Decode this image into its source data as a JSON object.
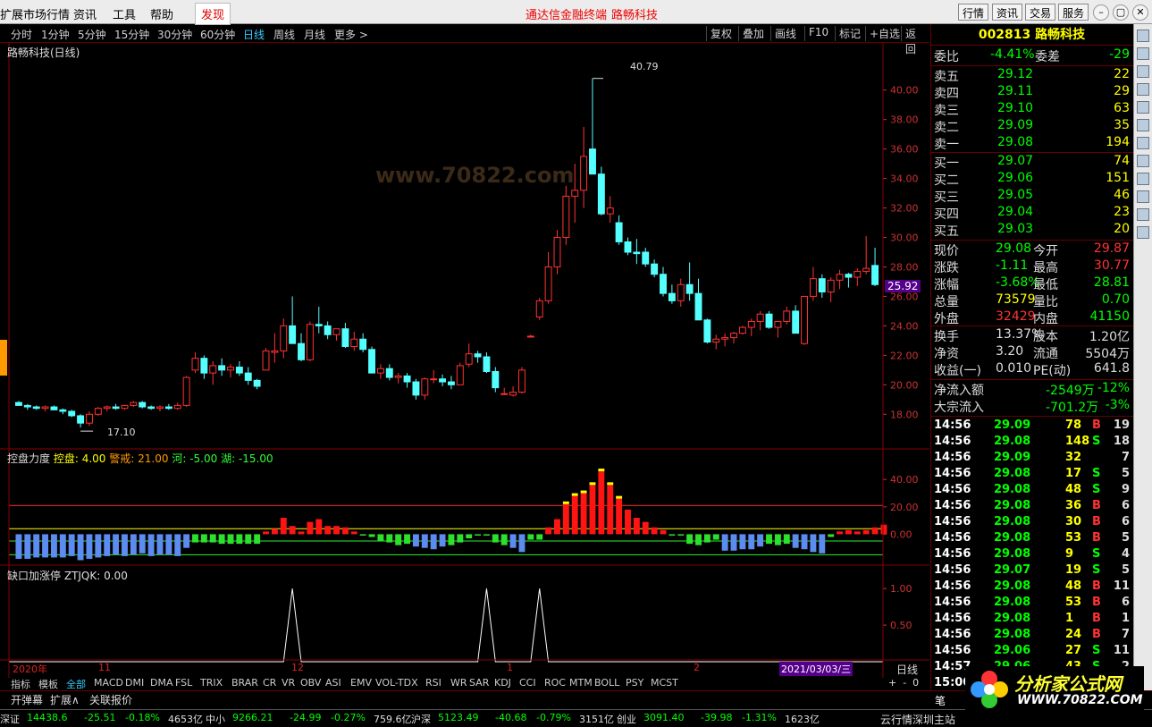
{
  "menubar": {
    "items": [
      "扩展市场行情",
      "资讯",
      "工具",
      "帮助"
    ],
    "find": "发现",
    "center_left": "通达信金融终端",
    "center_right": "路畅科技",
    "right_buttons": [
      "行情",
      "资讯",
      "交易",
      "服务"
    ]
  },
  "periods": {
    "items": [
      "分时",
      "1分钟",
      "5分钟",
      "15分钟",
      "30分钟",
      "60分钟",
      "日线",
      "周线",
      "月线",
      "更多 >"
    ],
    "active": "日线"
  },
  "toolbar": {
    "buttons": [
      "复权",
      "叠加",
      "画线",
      "F10",
      "标记",
      "+自选",
      "返回"
    ]
  },
  "main_chart": {
    "title": "路畅科技(日线)",
    "high_label": "40.79",
    "low_label": "17.10",
    "price_tag": "25.92",
    "watermark": "分析家公式网 WWW.70822.COM",
    "watermark_url": "www.70822.com"
  },
  "chart_data": [
    {
      "type": "candlestick",
      "name": "路畅科技",
      "yticks": [
        "40.00",
        "38.00",
        "36.00",
        "34.00",
        "32.00",
        "30.00",
        "28.00",
        "26.00",
        "24.00",
        "22.00",
        "20.00",
        "18.00"
      ],
      "ylim": [
        16.5,
        41.5
      ],
      "high": 40.79,
      "low": 17.1,
      "ohlc": [
        [
          18.8,
          18.9,
          18.6,
          18.6
        ],
        [
          18.6,
          18.7,
          18.3,
          18.5
        ],
        [
          18.5,
          18.6,
          18.3,
          18.4
        ],
        [
          18.4,
          18.6,
          18.2,
          18.5
        ],
        [
          18.5,
          18.6,
          18.3,
          18.3
        ],
        [
          18.3,
          18.4,
          18.0,
          18.2
        ],
        [
          18.2,
          18.3,
          17.8,
          17.9
        ],
        [
          17.9,
          18.0,
          17.1,
          17.4
        ],
        [
          17.4,
          18.2,
          17.2,
          18.0
        ],
        [
          18.0,
          18.5,
          17.9,
          18.4
        ],
        [
          18.4,
          18.6,
          18.2,
          18.5
        ],
        [
          18.5,
          18.7,
          18.3,
          18.4
        ],
        [
          18.4,
          18.6,
          18.3,
          18.6
        ],
        [
          18.6,
          18.9,
          18.5,
          18.8
        ],
        [
          18.8,
          18.9,
          18.4,
          18.5
        ],
        [
          18.5,
          18.6,
          18.3,
          18.4
        ],
        [
          18.4,
          18.6,
          18.2,
          18.5
        ],
        [
          18.5,
          18.7,
          18.3,
          18.4
        ],
        [
          18.4,
          18.8,
          18.3,
          18.6
        ],
        [
          18.6,
          20.6,
          18.5,
          20.5
        ],
        [
          21.0,
          22.2,
          20.8,
          21.8
        ],
        [
          21.8,
          22.0,
          20.4,
          20.8
        ],
        [
          20.8,
          21.6,
          20.0,
          21.3
        ],
        [
          21.3,
          21.8,
          20.6,
          21.0
        ],
        [
          21.0,
          21.4,
          20.5,
          21.2
        ],
        [
          21.2,
          21.6,
          20.6,
          20.8
        ],
        [
          20.8,
          21.2,
          20.0,
          20.3
        ],
        [
          20.3,
          20.4,
          19.7,
          19.9
        ],
        [
          21.0,
          22.5,
          21.0,
          22.3
        ],
        [
          22.2,
          23.5,
          21.5,
          22.3
        ],
        [
          22.3,
          24.5,
          21.8,
          24.0
        ],
        [
          24.0,
          26.0,
          23.0,
          22.8
        ],
        [
          22.8,
          23.5,
          21.6,
          21.7
        ],
        [
          21.7,
          24.3,
          21.6,
          24.1
        ],
        [
          24.1,
          25.3,
          23.5,
          24.0
        ],
        [
          24.0,
          24.3,
          23.1,
          23.4
        ],
        [
          23.4,
          23.8,
          23.0,
          23.8
        ],
        [
          23.8,
          24.2,
          22.5,
          22.6
        ],
        [
          22.6,
          23.6,
          22.3,
          23.1
        ],
        [
          23.1,
          23.5,
          22.2,
          22.4
        ],
        [
          22.4,
          22.6,
          20.8,
          20.8
        ],
        [
          20.8,
          21.4,
          20.4,
          21.1
        ],
        [
          21.1,
          21.4,
          20.3,
          20.5
        ],
        [
          20.5,
          20.8,
          20.1,
          20.6
        ],
        [
          20.6,
          20.8,
          19.8,
          20.2
        ],
        [
          20.2,
          20.4,
          19.0,
          19.3
        ],
        [
          19.3,
          20.5,
          19.0,
          20.4
        ],
        [
          20.4,
          21.0,
          20.1,
          20.4
        ],
        [
          20.4,
          20.7,
          19.9,
          20.2
        ],
        [
          20.2,
          20.6,
          19.7,
          20.0
        ],
        [
          20.0,
          21.5,
          20.0,
          21.3
        ],
        [
          21.4,
          22.8,
          21.2,
          22.1
        ],
        [
          22.1,
          22.3,
          21.5,
          21.9
        ],
        [
          21.9,
          22.2,
          20.8,
          20.9
        ],
        [
          20.9,
          21.2,
          19.5,
          19.8
        ],
        [
          19.4,
          19.8,
          19.3,
          19.4
        ],
        [
          19.3,
          19.9,
          19.2,
          19.5
        ],
        [
          19.5,
          21.2,
          19.4,
          21.0
        ],
        [
          23.3,
          23.4,
          23.2,
          23.3
        ],
        [
          24.6,
          25.9,
          24.4,
          25.7
        ],
        [
          25.7,
          29.0,
          25.5,
          28.0
        ],
        [
          28.0,
          30.5,
          27.5,
          30.0
        ],
        [
          30.0,
          33.5,
          29.5,
          32.8
        ],
        [
          32.8,
          35.0,
          31.0,
          33.2
        ],
        [
          33.2,
          37.5,
          32.0,
          35.5
        ],
        [
          36.0,
          40.8,
          34.5,
          34.3
        ],
        [
          34.3,
          34.8,
          31.5,
          31.6
        ],
        [
          31.6,
          32.8,
          31.0,
          32.0
        ],
        [
          31.0,
          31.5,
          29.5,
          29.7
        ],
        [
          29.7,
          30.0,
          28.8,
          29.0
        ],
        [
          29.0,
          29.9,
          28.2,
          28.9
        ],
        [
          29.0,
          29.3,
          28.0,
          28.2
        ],
        [
          28.2,
          28.5,
          27.3,
          27.5
        ],
        [
          27.5,
          28.0,
          26.0,
          26.2
        ],
        [
          26.2,
          26.8,
          25.5,
          25.7
        ],
        [
          25.7,
          27.2,
          25.3,
          26.8
        ],
        [
          26.8,
          28.3,
          25.7,
          26.2
        ],
        [
          26.2,
          27.2,
          24.4,
          24.4
        ],
        [
          24.4,
          24.5,
          22.8,
          22.9
        ],
        [
          22.9,
          23.4,
          22.4,
          23.1
        ],
        [
          23.1,
          23.5,
          22.6,
          23.2
        ],
        [
          23.2,
          23.6,
          22.8,
          23.5
        ],
        [
          23.5,
          24.0,
          23.4,
          23.9
        ],
        [
          23.9,
          24.5,
          23.3,
          24.3
        ],
        [
          24.3,
          25.0,
          23.7,
          24.8
        ],
        [
          24.8,
          25.0,
          23.8,
          23.9
        ],
        [
          23.9,
          24.2,
          23.2,
          24.3
        ],
        [
          24.3,
          25.3,
          24.1,
          25.0
        ],
        [
          25.0,
          25.4,
          23.5,
          23.5
        ],
        [
          22.8,
          26.0,
          22.7,
          26.0
        ],
        [
          26.0,
          28.0,
          25.7,
          27.2
        ],
        [
          27.2,
          27.5,
          25.9,
          26.3
        ],
        [
          26.3,
          27.3,
          25.6,
          27.1
        ],
        [
          27.1,
          27.8,
          26.5,
          27.5
        ],
        [
          27.5,
          27.6,
          26.6,
          27.3
        ],
        [
          27.3,
          27.9,
          26.7,
          27.7
        ],
        [
          27.7,
          30.1,
          27.5,
          27.9
        ],
        [
          28.1,
          29.3,
          26.7,
          26.8
        ]
      ]
    },
    {
      "type": "bar",
      "name": "控盘力度",
      "legend": [
        {
          "name": "控盘",
          "value": "4.00"
        },
        {
          "name": "警戒",
          "value": "21.00"
        },
        {
          "name": "河",
          "value": "-5.00"
        },
        {
          "name": "湖",
          "value": "-15.00"
        }
      ],
      "yticks": [
        "40.00",
        "20.00",
        "0.00"
      ],
      "ylim": [
        -20,
        48
      ],
      "values": [
        -18,
        -18,
        -17,
        -17,
        -17,
        -17,
        -16,
        -19,
        -18,
        -17,
        -16,
        -15,
        -16,
        -15,
        -14,
        -16,
        -15,
        -15,
        -16,
        -10,
        -6,
        -6,
        -6,
        -7,
        -7,
        -7,
        -7,
        -7,
        2,
        4,
        12,
        6,
        2,
        9,
        11,
        6,
        6,
        5,
        2,
        -1,
        -2,
        -5,
        -6,
        -8,
        -7,
        -9,
        -10,
        -11,
        -9,
        -8,
        -6,
        -3,
        -1,
        -1,
        -6,
        -8,
        -10,
        -13,
        -4,
        -4,
        5,
        11,
        22,
        28,
        30,
        36,
        46,
        36,
        26,
        18,
        12,
        9,
        5,
        3,
        -1,
        -1,
        -7,
        -8,
        -6,
        -4,
        -12,
        -12,
        -11,
        -11,
        -9,
        -7,
        -8,
        -7,
        -10,
        -11,
        -13,
        -14,
        -2,
        2,
        3,
        2,
        3,
        5,
        7
      ]
    },
    {
      "type": "line",
      "name": "缺口加涨停",
      "legend": [
        {
          "name": "ZTJQK",
          "value": "0.00"
        }
      ],
      "yticks": [
        "1.00",
        "0.50"
      ],
      "ylim": [
        0,
        1.1
      ],
      "peaks": [
        31,
        53,
        59
      ]
    }
  ],
  "xaxis": {
    "labels": [
      "2020年",
      "11",
      "12",
      "1",
      "2"
    ],
    "date_tag": "2021/03/03/三",
    "period": "日线"
  },
  "indicator_tabs": [
    "指标",
    "模板",
    "全部",
    "MACD",
    "DMI",
    "DMA",
    "FSL",
    "TRIX",
    "BRAR",
    "CR",
    "VR",
    "OBV",
    "ASI",
    "EMV",
    "VOL-TDX",
    "RSI",
    "WR",
    "SAR",
    "KDJ",
    "CCI",
    "ROC",
    "MTM",
    "BOLL",
    "PSY",
    "MCST"
  ],
  "bottom_tabs": [
    "开弹幕",
    "扩展∧",
    "关联报价"
  ],
  "quote": {
    "code": "002813",
    "name": "路畅科技",
    "weibi": {
      "label": "委比",
      "value": "-4.41%",
      "label2": "委差",
      "value2": "-29"
    },
    "sell": [
      {
        "label": "卖五",
        "price": "29.12",
        "vol": "22"
      },
      {
        "label": "卖四",
        "price": "29.11",
        "vol": "29"
      },
      {
        "label": "卖三",
        "price": "29.10",
        "vol": "63"
      },
      {
        "label": "卖二",
        "price": "29.09",
        "vol": "35"
      },
      {
        "label": "卖一",
        "price": "29.08",
        "vol": "194"
      }
    ],
    "buy": [
      {
        "label": "买一",
        "price": "29.07",
        "vol": "74"
      },
      {
        "label": "买二",
        "price": "29.06",
        "vol": "151"
      },
      {
        "label": "买三",
        "price": "29.05",
        "vol": "46"
      },
      {
        "label": "买四",
        "price": "29.04",
        "vol": "23"
      },
      {
        "label": "买五",
        "price": "29.03",
        "vol": "20"
      }
    ],
    "stats": [
      {
        "l1": "现价",
        "v1": "29.08",
        "l2": "今开",
        "v2": "29.87"
      },
      {
        "l1": "涨跌",
        "v1": "-1.11",
        "l2": "最高",
        "v2": "30.77"
      },
      {
        "l1": "涨幅",
        "v1": "-3.68%",
        "l2": "最低",
        "v2": "28.81"
      },
      {
        "l1": "总量",
        "v1": "73579",
        "l2": "量比",
        "v2": "0.70"
      },
      {
        "l1": "外盘",
        "v1": "32429",
        "l2": "内盘",
        "v2": "41150"
      }
    ],
    "stats2": [
      {
        "l1": "换手",
        "v1": "13.37%",
        "l2": "股本",
        "v2": "1.20亿"
      },
      {
        "l1": "净资",
        "v1": "3.20",
        "l2": "流通",
        "v2": "5504万"
      },
      {
        "l1": "收益(一)",
        "v1": "0.010",
        "l2": "PE(动)",
        "v2": "641.8"
      }
    ],
    "flows": [
      {
        "label": "净流入额",
        "v1": "-2549万",
        "v2": "-12%"
      },
      {
        "label": "大宗流入",
        "v1": "-701.2万",
        "v2": "-3%"
      }
    ],
    "ticks": [
      {
        "t": "14:56",
        "p": "29.09",
        "v": "78",
        "d": "B",
        "n": "19"
      },
      {
        "t": "14:56",
        "p": "29.08",
        "v": "148",
        "d": "S",
        "n": "18"
      },
      {
        "t": "14:56",
        "p": "29.09",
        "v": "32",
        "d": "",
        "n": "7"
      },
      {
        "t": "14:56",
        "p": "29.08",
        "v": "17",
        "d": "S",
        "n": "5"
      },
      {
        "t": "14:56",
        "p": "29.08",
        "v": "48",
        "d": "S",
        "n": "9"
      },
      {
        "t": "14:56",
        "p": "29.08",
        "v": "36",
        "d": "B",
        "n": "6"
      },
      {
        "t": "14:56",
        "p": "29.08",
        "v": "30",
        "d": "B",
        "n": "6"
      },
      {
        "t": "14:56",
        "p": "29.08",
        "v": "53",
        "d": "B",
        "n": "5"
      },
      {
        "t": "14:56",
        "p": "29.08",
        "v": "9",
        "d": "S",
        "n": "4"
      },
      {
        "t": "14:56",
        "p": "29.07",
        "v": "19",
        "d": "S",
        "n": "5"
      },
      {
        "t": "14:56",
        "p": "29.08",
        "v": "48",
        "d": "B",
        "n": "11"
      },
      {
        "t": "14:56",
        "p": "29.08",
        "v": "53",
        "d": "B",
        "n": "6"
      },
      {
        "t": "14:56",
        "p": "29.08",
        "v": "1",
        "d": "B",
        "n": "1"
      },
      {
        "t": "14:56",
        "p": "29.08",
        "v": "24",
        "d": "B",
        "n": "7"
      },
      {
        "t": "14:56",
        "p": "29.06",
        "v": "27",
        "d": "S",
        "n": "11"
      },
      {
        "t": "14:57",
        "p": "29.06",
        "v": "43",
        "d": "S",
        "n": "2"
      },
      {
        "t": "15:00",
        "p": "",
        "v": "",
        "d": "",
        "n": ""
      }
    ]
  },
  "status": {
    "items": [
      {
        "name": "深证",
        "value": "14438.6",
        "chg": "-25.51",
        "pct": "-0.18%",
        "amt": "4653亿"
      },
      {
        "name": "中小",
        "value": "9266.21",
        "chg": "-24.99",
        "pct": "-0.27%",
        "amt": "759.6亿"
      },
      {
        "name": "沪深",
        "value": "5123.49",
        "chg": "-40.68",
        "pct": "-0.79%",
        "amt": "3151亿"
      },
      {
        "name": "创业",
        "value": "3091.40",
        "chg": "-39.98",
        "pct": "-1.31%",
        "amt": "1623亿"
      }
    ],
    "right": "云行情深圳主站",
    "logo": "分析家公式网",
    "logo_url": "WWW.70822.COM",
    "mini": "笔"
  }
}
